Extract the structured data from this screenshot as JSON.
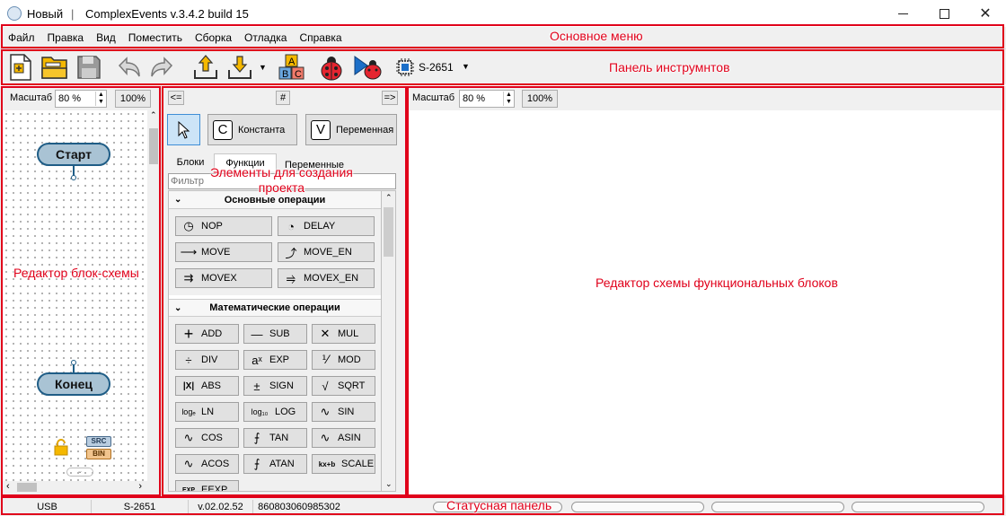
{
  "titlebar": {
    "doc_name": "Новый",
    "separator": "|",
    "app_name": "ComplexEvents v.3.4.2 build 15"
  },
  "menu": [
    "Файл",
    "Правка",
    "Вид",
    "Поместить",
    "Сборка",
    "Отладка",
    "Справка"
  ],
  "toolbar": {
    "device": "S-2651"
  },
  "left_panel": {
    "scale_label": "Масштаб",
    "scale_value": "80 %",
    "reset_label": "100%",
    "start_label": "Старт",
    "end_label": "Конец",
    "src_label": "SRC",
    "bin_label": "BIN"
  },
  "mid_panel": {
    "nav_left": "<=",
    "nav_hash": "#",
    "nav_right": "=>",
    "const_label": "Константа",
    "const_letter": "C",
    "var_label": "Переменная",
    "var_letter": "V",
    "tabs": [
      "Блоки",
      "Функции",
      "Переменные"
    ],
    "filter_placeholder": "Фильтр",
    "section1": "Основные операции",
    "section2": "Математические операции",
    "basic_ops": [
      {
        "label": "NOP",
        "icon": "◷"
      },
      {
        "label": "DELAY",
        "icon": "◔"
      },
      {
        "label": "MOVE",
        "icon": "⟶"
      },
      {
        "label": "MOVE_EN",
        "icon": "⤴"
      },
      {
        "label": "MOVEX",
        "icon": "⇉"
      },
      {
        "label": "MOVEX_EN",
        "icon": "⥤"
      }
    ],
    "math_ops": [
      {
        "label": "ADD",
        "icon": "+"
      },
      {
        "label": "SUB",
        "icon": "—"
      },
      {
        "label": "MUL",
        "icon": "✕"
      },
      {
        "label": "DIV",
        "icon": "÷"
      },
      {
        "label": "EXP",
        "icon": "aˣ"
      },
      {
        "label": "MOD",
        "icon": "⅟"
      },
      {
        "label": "ABS",
        "icon": "|X|"
      },
      {
        "label": "SIGN",
        "icon": "±"
      },
      {
        "label": "SQRT",
        "icon": "√"
      },
      {
        "label": "LN",
        "icon": "logₑ"
      },
      {
        "label": "LOG",
        "icon": "log₁₀"
      },
      {
        "label": "SIN",
        "icon": "∿"
      },
      {
        "label": "COS",
        "icon": "∿"
      },
      {
        "label": "TAN",
        "icon": "⨍"
      },
      {
        "label": "ASIN",
        "icon": "∿"
      },
      {
        "label": "ACOS",
        "icon": "∿"
      },
      {
        "label": "ATAN",
        "icon": "⨍"
      },
      {
        "label": "SCALE",
        "icon": "kx+b"
      },
      {
        "label": "EEXP",
        "icon": "EXP"
      }
    ]
  },
  "right_panel": {
    "scale_label": "Масштаб",
    "scale_value": "80 %",
    "reset_label": "100%"
  },
  "status": {
    "port": "USB",
    "device": "S-2651",
    "version": "v.02.02.52",
    "serial": "860803060985302"
  },
  "annotations": {
    "menu": "Основное меню",
    "toolbar": "Панель инструмнтов",
    "elements": "Элементы для создания\nпроекта",
    "flow_editor": "Редактор блок-схемы",
    "fb_editor": "Редактор схемы функциональных блоков",
    "status": "Статусная панель"
  },
  "colors": {
    "annotation": "#e0001a",
    "node_fill": "#a9c3d4",
    "node_border": "#1f5d86"
  }
}
